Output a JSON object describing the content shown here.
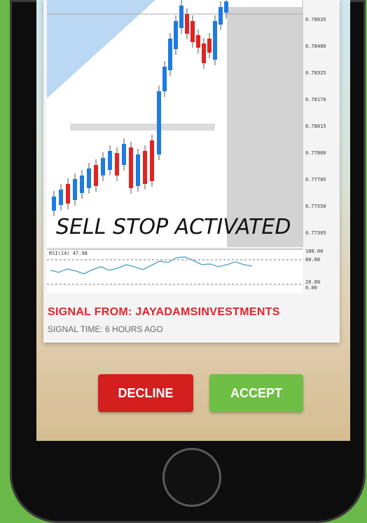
{
  "chart": {
    "overlay_text": "SELL STOP ACTIVATED",
    "price_labels": [
      "0.78635",
      "0.78480",
      "0.78325",
      "0.78170",
      "0.78015",
      "0.77860",
      "0.77705",
      "0.77550",
      "0.77395"
    ],
    "rsi_label": "RSI(14) 47.98",
    "rsi_levels": [
      "100.00",
      "80.00",
      "20.00",
      "0.00"
    ]
  },
  "signal": {
    "from_text": "SIGNAL FROM: JAYADAMSINVESTMENTS",
    "time_text": "SIGNAL TIME: 6 HOURS  AGO"
  },
  "actions": {
    "decline_label": "DECLINE",
    "accept_label": "ACCEPT"
  },
  "colors": {
    "bull": "#1e7be0",
    "bear": "#e02424",
    "accept": "#6fbe46",
    "decline": "#d41f1f",
    "signal_text": "#e3242b"
  }
}
